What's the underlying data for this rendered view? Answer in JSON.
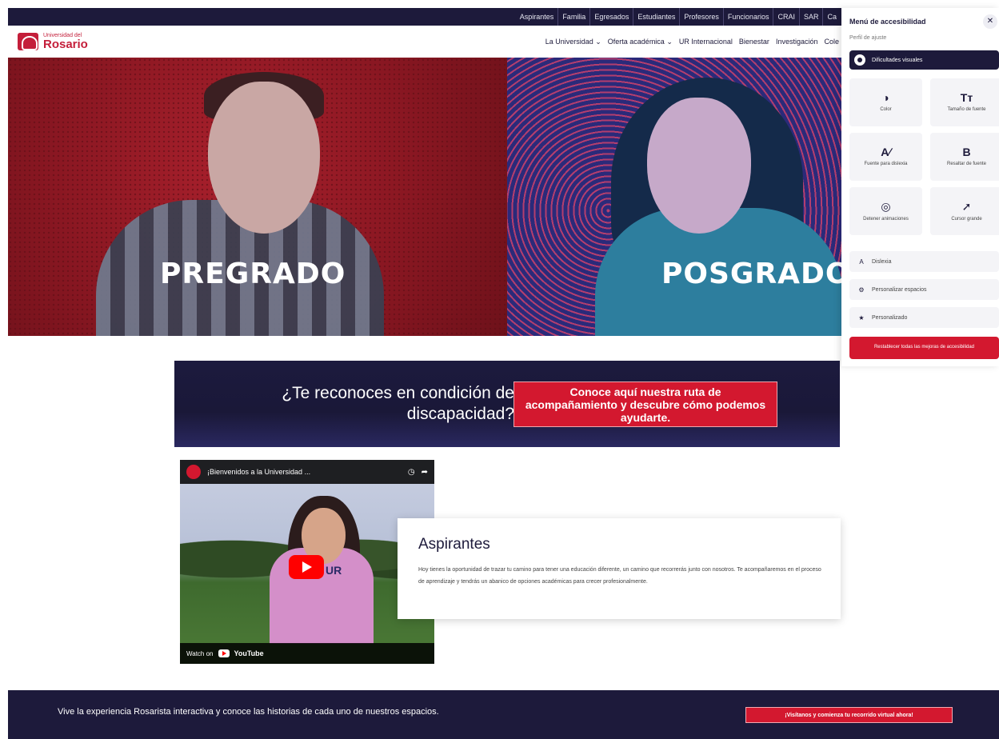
{
  "topbar": {
    "links": [
      "Aspirantes",
      "Familia",
      "Egresados",
      "Estudiantes",
      "Profesores",
      "Funcionarios",
      "CRAI",
      "SAR",
      "Ca"
    ]
  },
  "header": {
    "logo_small": "Universidad del",
    "logo_big": "Rosario",
    "nav": [
      "La Universidad ⌄",
      "Oferta académica ⌄",
      "UR Internacional",
      "Bienestar",
      "Investigación",
      "Cole"
    ]
  },
  "hero": {
    "left_label": "PREGRADO",
    "right_label": "POSGRADO",
    "colors": {
      "left": "#8a1722",
      "right": "#2b2a7a"
    }
  },
  "accessibility_menu": {
    "title": "Menú de accesibilidad",
    "close_icon": "close-icon",
    "subtitle": "Perfil de ajuste",
    "profile": "Dificultades visuales",
    "tiles": [
      {
        "icon": "contrast-icon",
        "glyph": "◑",
        "label": "Color"
      },
      {
        "icon": "text-size-icon",
        "glyph": "Tт",
        "label": "Tamaño de fuente"
      },
      {
        "icon": "dyslexia-font-icon",
        "glyph": "A∕",
        "label": "Fuente para dislexia"
      },
      {
        "icon": "bold-icon",
        "glyph": "B",
        "label": "Resaltar de fuente"
      },
      {
        "icon": "stop-animation-icon",
        "glyph": "◎",
        "label": "Detener animaciones"
      },
      {
        "icon": "cursor-icon",
        "glyph": "➚",
        "label": "Cursor grande"
      }
    ],
    "rows": [
      {
        "icon": "font-icon",
        "glyph": "A",
        "label": "Dislexia"
      },
      {
        "icon": "gear-icon",
        "glyph": "⚙",
        "label": "Personalizar espacios"
      },
      {
        "icon": "star-icon",
        "glyph": "★",
        "label": "Personalizado"
      }
    ],
    "reset": "Restablecer todas las mejoras de accesibilidad"
  },
  "disability_banner": {
    "question": "¿Te reconoces en condición de discapacidad?",
    "button": "Conoce aquí nuestra ruta de acompañamiento y descubre cómo podemos ayudarte."
  },
  "video": {
    "title": "¡Bienvenidos a la Universidad ...",
    "watch_on": "Watch on",
    "youtube": "YouTube",
    "shirt_text": "UR"
  },
  "aspirantes": {
    "title": "Aspirantes",
    "text": "Hoy tienes la oportunidad de trazar tu camino para tener una educación diferente, un camino que recorrerás junto con nosotros. Te acompañaremos en el proceso de aprendizaje y tendrás un abanico de opciones académicas para crecer profesionalmente."
  },
  "bottom_banner": {
    "text": "Vive la experiencia Rosarista interactiva y conoce las historias de cada uno de nuestros espacios.",
    "button": "¡Visítanos y comienza tu recorrido virtual ahora!"
  }
}
